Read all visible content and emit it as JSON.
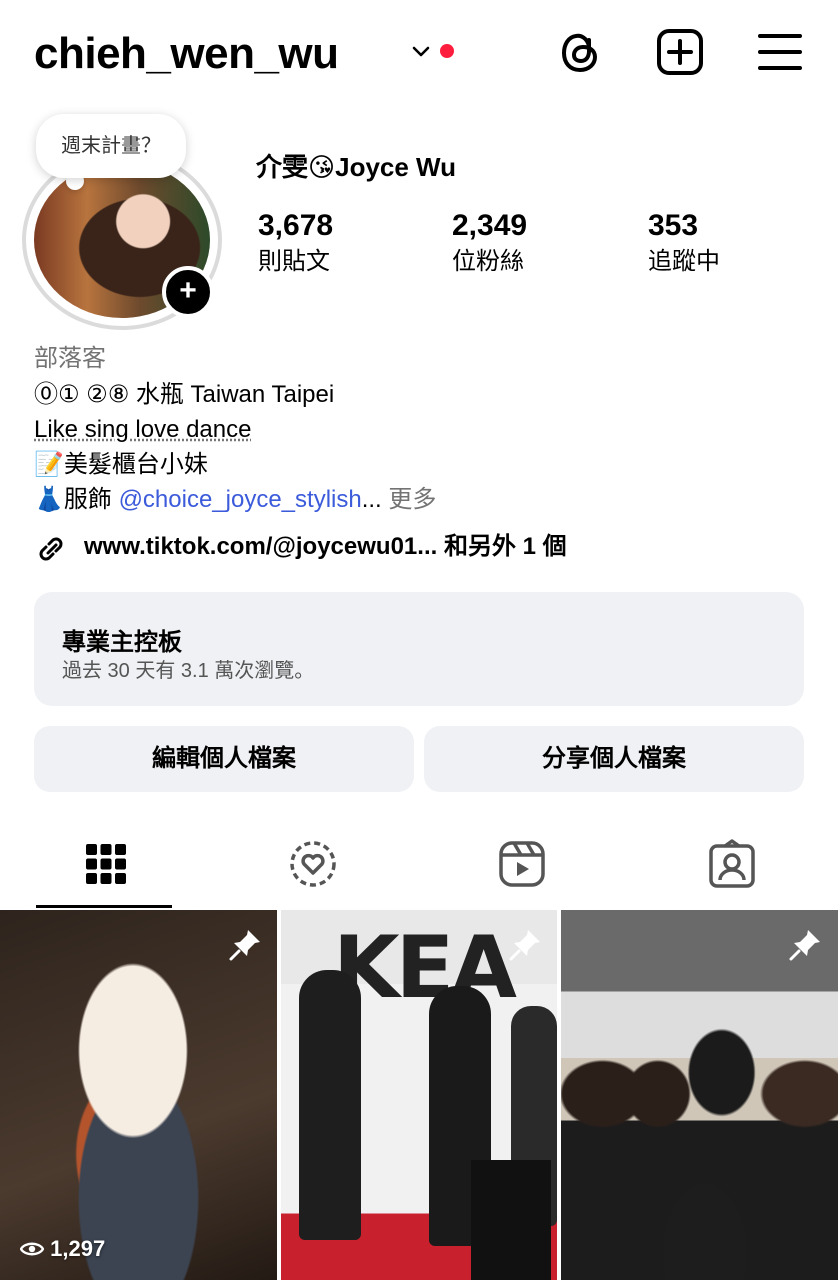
{
  "header": {
    "username": "chieh_wen_wu",
    "icons": [
      "threads-icon",
      "new-post-icon",
      "menu-icon"
    ]
  },
  "profile": {
    "note": "週末計畫？",
    "display_name": "介雯😘Joyce  Wu",
    "stats": [
      {
        "value": "3,678",
        "label": "則貼文"
      },
      {
        "value": "2,349",
        "label": "位粉絲"
      },
      {
        "value": "353",
        "label": "追蹤中"
      }
    ]
  },
  "bio": {
    "category": "部落客",
    "line1": "⓪① ②⑧ 水瓶 Taiwan Taipei",
    "line2": "Like sing love dance",
    "line3": "📝美髮櫃台小妹",
    "line4_prefix": "👗服飾 ",
    "line4_mention": "@choice_joyce_stylish",
    "line4_ellipsis": "...",
    "line4_more": " 更多",
    "link": "www.tiktok.com/@joycewu01... 和另外 1 個"
  },
  "dashboard": {
    "title": "專業主控板",
    "subtitle": "過去 30 天有 3.1 萬次瀏覽。"
  },
  "buttons": {
    "edit": "編輯個人檔案",
    "share": "分享個人檔案"
  },
  "tabs": [
    "grid-icon",
    "tagged-circle-icon",
    "reels-icon",
    "tagged-person-icon"
  ],
  "posts": [
    {
      "views": "1,297",
      "pinned": true
    },
    {
      "pinned": true
    },
    {
      "pinned": true
    }
  ]
}
